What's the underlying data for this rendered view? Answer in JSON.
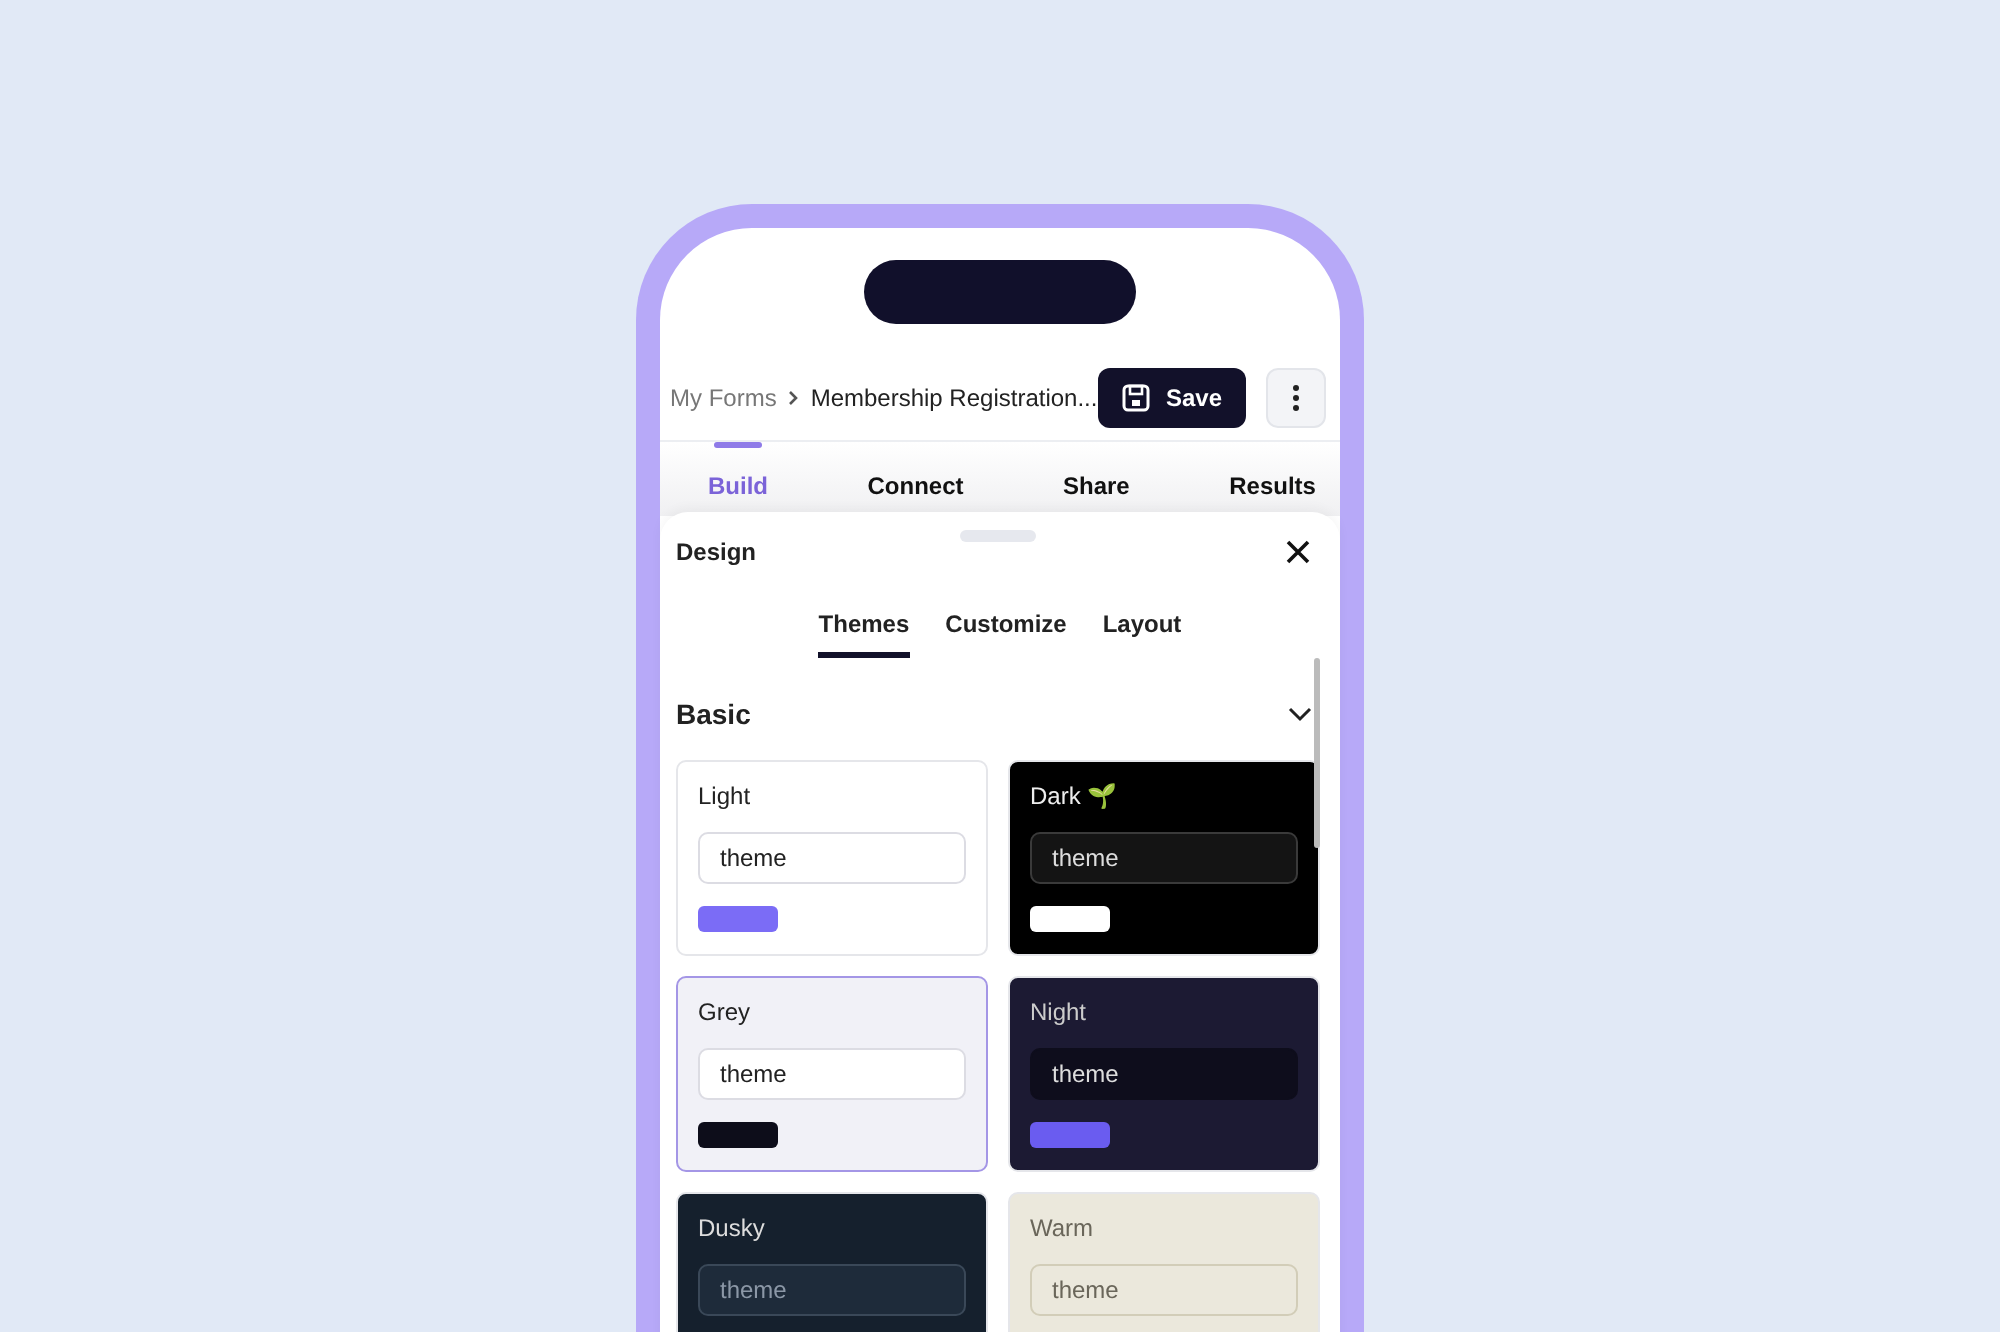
{
  "breadcrumb": {
    "parent": "My Forms",
    "current": "Membership Registration..."
  },
  "save_button": "Save",
  "tabs": [
    {
      "label": "Build",
      "selected": true
    },
    {
      "label": "Connect",
      "selected": false
    },
    {
      "label": "Share",
      "selected": false
    },
    {
      "label": "Results",
      "selected": false
    }
  ],
  "design_panel": {
    "title": "Design",
    "tabs": [
      {
        "label": "Themes",
        "selected": true
      },
      {
        "label": "Customize",
        "selected": false
      },
      {
        "label": "Layout",
        "selected": false
      }
    ],
    "section": {
      "title": "Basic",
      "expanded": true
    },
    "themes": [
      {
        "name": "Light",
        "field": "theme",
        "kind": "light",
        "color": "#ffffff",
        "sample_button": {
          "color": "#7b6cf6"
        },
        "selected": false
      },
      {
        "name": "Dark 🌱",
        "field": "theme",
        "kind": "dark",
        "color": "#000000",
        "sample_button": {
          "color": "#ffffff"
        },
        "selected": false
      },
      {
        "name": "Grey",
        "field": "theme",
        "kind": "light",
        "color": "#f1f1f7",
        "sample_button": {
          "color": "#0d0d1a"
        },
        "selected": true
      },
      {
        "name": "Night",
        "field": "theme",
        "kind": "night",
        "color": "#1c1a33",
        "sample_button": {
          "color": "#6a5cf0"
        },
        "selected": false
      },
      {
        "name": "Dusky",
        "field": "theme",
        "kind": "dusky",
        "color": "#15202d",
        "selected": false
      },
      {
        "name": "Warm",
        "field": "theme",
        "kind": "warm",
        "color": "#ebe8dc",
        "selected": false
      }
    ]
  }
}
